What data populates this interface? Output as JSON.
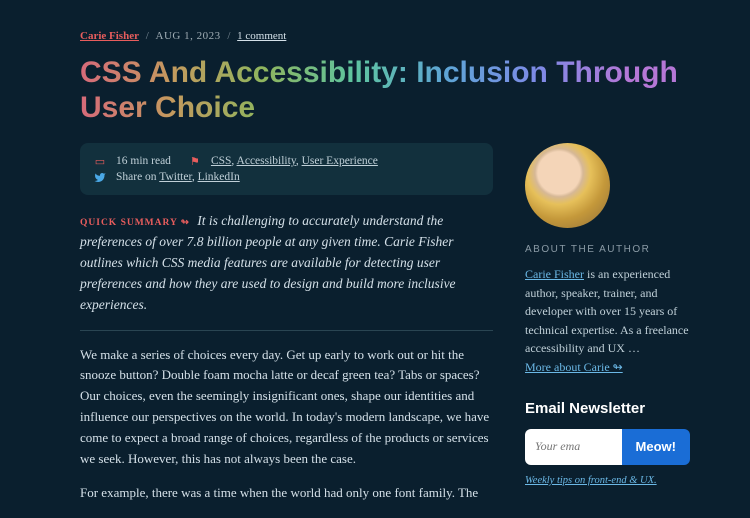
{
  "meta": {
    "author": "Carie Fisher",
    "date": "AUG 1, 2023",
    "comments": "1 comment"
  },
  "title": "CSS And Accessibility: Inclusion Through User Choice",
  "infobox": {
    "read_time": "16 min read",
    "tags_prefix": "",
    "tag1": "CSS",
    "tag2": "Accessibility",
    "tag3": "User Experience",
    "share_prefix": "Share on ",
    "share1": "Twitter",
    "share2": "LinkedIn"
  },
  "summary": {
    "label": "QUICK SUMMARY ↬",
    "text": "It is challenging to accurately understand the preferences of over 7.8 billion people at any given time. Carie Fisher outlines which CSS media features are available for detecting user preferences and how they are used to design and build more inclusive experiences."
  },
  "body": {
    "p1": "We make a series of choices every day. Get up early to work out or hit the snooze button? Double foam mocha latte or decaf green tea? Tabs or spaces? Our choices, even the seemingly insignificant ones, shape our identities and influence our perspectives on the world. In today's modern landscape, we have come to expect a broad range of choices, regardless of the products or services we seek. However, this has not always been the case.",
    "p2": "For example, there was a time when the world had only one font family. The"
  },
  "sidebar": {
    "about_heading": "ABOUT THE AUTHOR",
    "about_name": "Carie Fisher",
    "about_text": " is an experienced author, speaker, trainer, and developer with over 15 years of technical expertise. As a freelance accessibility and UX …",
    "about_more": "More about Carie ↬",
    "newsletter_heading": "Email Newsletter",
    "email_placeholder": "Your ema",
    "subscribe_label": "Meow!",
    "newsletter_sub": "Weekly tips on front-end & UX."
  }
}
